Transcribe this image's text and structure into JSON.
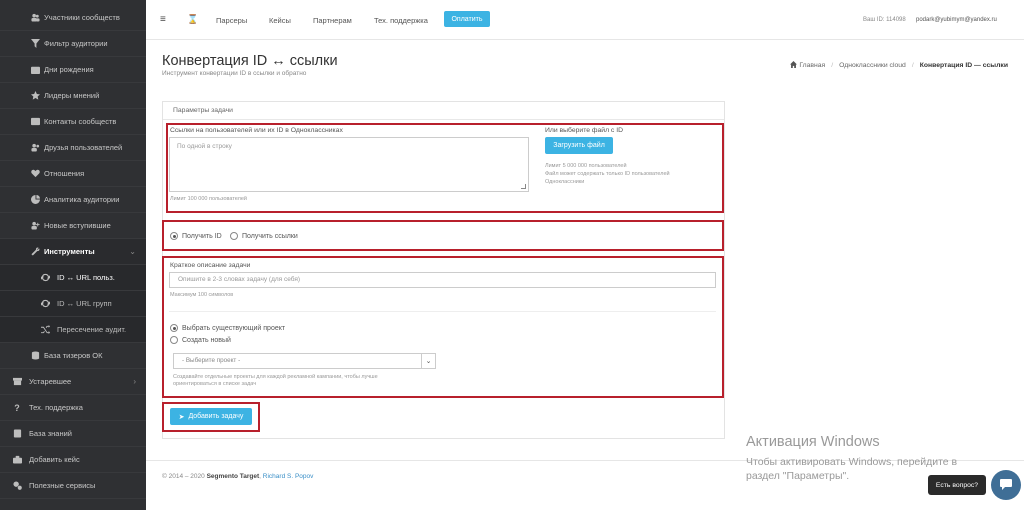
{
  "sidebar": {
    "items": [
      {
        "label": "Участники сообществ",
        "icon": "users-icon"
      },
      {
        "label": "Фильтр аудитории",
        "icon": "filter-icon"
      },
      {
        "label": "Дни рождения",
        "icon": "calendar-icon"
      },
      {
        "label": "Лидеры мнений",
        "icon": "star-icon"
      },
      {
        "label": "Контакты сообществ",
        "icon": "contacts-icon"
      },
      {
        "label": "Друзья пользователей",
        "icon": "friends-icon"
      },
      {
        "label": "Отношения",
        "icon": "heart-icon"
      },
      {
        "label": "Аналитика аудитории",
        "icon": "pie-chart-icon"
      },
      {
        "label": "Новые вступившие",
        "icon": "user-plus-icon"
      },
      {
        "label": "Инструменты",
        "icon": "wrench-icon"
      },
      {
        "label": "ID ↔ URL польз.",
        "icon": "refresh-icon"
      },
      {
        "label": "ID ↔ URL групп",
        "icon": "refresh-icon"
      },
      {
        "label": "Пересечение аудит.",
        "icon": "shuffle-icon"
      },
      {
        "label": "База тизеров ОК",
        "icon": "database-icon"
      },
      {
        "label": "Устаревшее",
        "icon": "archive-icon"
      },
      {
        "label": "Тех. поддержка",
        "icon": "question-icon"
      },
      {
        "label": "База знаний",
        "icon": "book-icon"
      },
      {
        "label": "Добавить кейс",
        "icon": "briefcase-icon"
      },
      {
        "label": "Полезные сервисы",
        "icon": "gears-icon"
      }
    ]
  },
  "topbar": {
    "links": [
      "Парсеры",
      "Кейсы",
      "Партнерам",
      "Тех. поддержка"
    ],
    "pay_label": "Оплатить",
    "user_id": "Ваш ID: 114098",
    "email": "podark@yubimym@yandex.ru"
  },
  "page": {
    "title": "Конвертация ID ↔ ссылки",
    "subtitle": "Инструмент конвертации ID в ссылки и обратно",
    "breadcrumb": {
      "home": "Главная",
      "section": "Одноклассники cloud",
      "current": "Конвертация ID — ссылки"
    }
  },
  "form": {
    "panel_title": "Параметры задачи",
    "links_label": "Ссылки на пользователей или их ID в Одноклассниках",
    "links_placeholder": "По одной в строку",
    "links_limit": "Лимит 100 000 пользователей",
    "file_label": "Или выберите файл с ID",
    "upload_label": "Загрузить файл",
    "file_hint_1": "Лимит 5 000 000 пользователей",
    "file_hint_2": "Файл может содержать только ID пользователей",
    "file_hint_3": "Одноклассники",
    "mode_get_id": "Получить ID",
    "mode_get_links": "Получить ссылки",
    "desc_label": "Краткое описание задачи",
    "desc_placeholder": "Опишите в 2-3 словах задачу (для себя)",
    "desc_max": "Максимум 100 символов",
    "project_existing": "Выбрать существующий проект",
    "project_new": "Создать новый",
    "project_select": "- Выберите проект -",
    "project_hint_1": "Создавайте отдельные проекты для каждой рекламной кампании, чтобы лучше",
    "project_hint_2": "ориентироваться в списке задач",
    "add_task": "Добавить задачу"
  },
  "footer": {
    "copyright": "© 2014 – 2020",
    "brand": "Segmento Target",
    "author": "Richard S. Popov"
  },
  "windows": {
    "title": "Активация Windows",
    "line1": "Чтобы активировать Windows, перейдите в",
    "line2": "раздел \"Параметры\"."
  },
  "chat": {
    "label": "Есть вопрос?"
  }
}
